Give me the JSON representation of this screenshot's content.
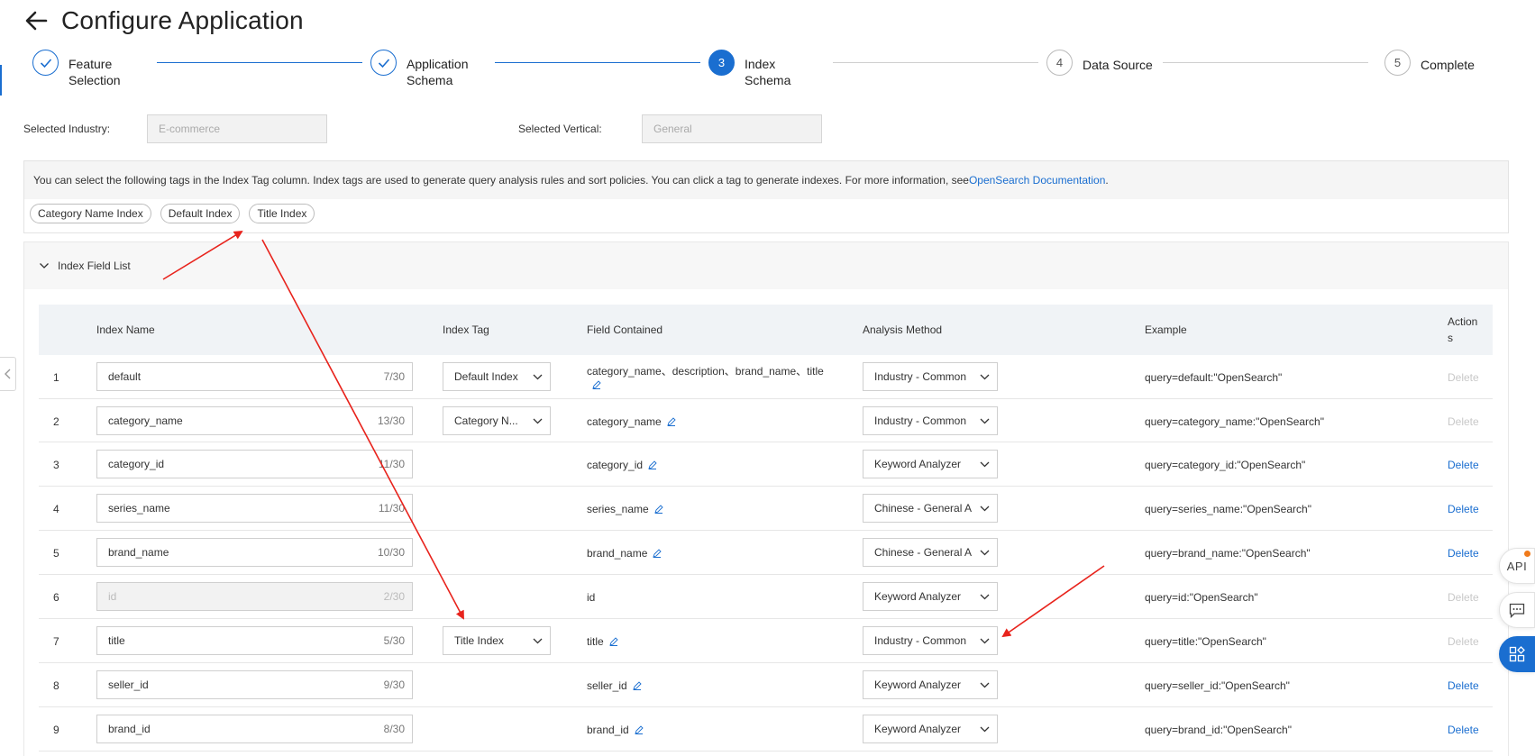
{
  "header": {
    "title": "Configure Application"
  },
  "steps": [
    {
      "number": "1",
      "label": "Feature\nSelection",
      "state": "done"
    },
    {
      "number": "2",
      "label": "Application\nSchema",
      "state": "done"
    },
    {
      "number": "3",
      "label": "Index\nSchema",
      "state": "active"
    },
    {
      "number": "4",
      "label": "Data Source",
      "state": "todo"
    },
    {
      "number": "5",
      "label": "Complete",
      "state": "todo"
    }
  ],
  "selection": {
    "industry_label": "Selected Industry:",
    "industry_value": "E-commerce",
    "vertical_label": "Selected Vertical:",
    "vertical_value": "General"
  },
  "info": {
    "text": "You can select the following tags in the Index Tag column. Index tags are used to generate query analysis rules and sort policies. You can click a tag to generate indexes. For more information, see",
    "link": "OpenSearch Documentation",
    "suffix": ".",
    "tags": [
      "Category Name Index",
      "Default Index",
      "Title Index"
    ]
  },
  "panel": {
    "title": "Index Field List"
  },
  "table": {
    "headers": {
      "index_name": "Index Name",
      "index_tag": "Index Tag",
      "field": "Field Contained",
      "method": "Analysis Method",
      "example": "Example",
      "actions": "Action\ns"
    },
    "rows": [
      {
        "n": "1",
        "name": "default",
        "count": "7/30",
        "tag": "Default Index",
        "field": "category_name、description、brand_name、title",
        "method": "Industry - Common",
        "example": "query=default:\"OpenSearch\"",
        "action": "Delete"
      },
      {
        "n": "2",
        "name": "category_name",
        "count": "13/30",
        "tag": "Category N...",
        "field": "category_name",
        "method": "Industry - Common",
        "example": "query=category_name:\"OpenSearch\"",
        "action": "Delete"
      },
      {
        "n": "3",
        "name": "category_id",
        "count": "11/30",
        "tag": "",
        "field": "category_id",
        "method": "Keyword Analyzer",
        "example": "query=category_id:\"OpenSearch\"",
        "action": "Delete"
      },
      {
        "n": "4",
        "name": "series_name",
        "count": "11/30",
        "tag": "",
        "field": "series_name",
        "method": "Chinese - General A",
        "example": "query=series_name:\"OpenSearch\"",
        "action": "Delete"
      },
      {
        "n": "5",
        "name": "brand_name",
        "count": "10/30",
        "tag": "",
        "field": "brand_name",
        "method": "Chinese - General A",
        "example": "query=brand_name:\"OpenSearch\"",
        "action": "Delete"
      },
      {
        "n": "6",
        "name": "id",
        "count": "2/30",
        "tag": "",
        "field": "id",
        "method": "Keyword Analyzer",
        "example": "query=id:\"OpenSearch\"",
        "action": "Delete"
      },
      {
        "n": "7",
        "name": "title",
        "count": "5/30",
        "tag": "Title Index",
        "field": "title",
        "method": "Industry - Common",
        "example": "query=title:\"OpenSearch\"",
        "action": "Delete"
      },
      {
        "n": "8",
        "name": "seller_id",
        "count": "9/30",
        "tag": "",
        "field": "seller_id",
        "method": "Keyword Analyzer",
        "example": "query=seller_id:\"OpenSearch\"",
        "action": "Delete"
      },
      {
        "n": "9",
        "name": "brand_id",
        "count": "8/30",
        "tag": "",
        "field": "brand_id",
        "method": "Keyword Analyzer",
        "example": "query=brand_id:\"OpenSearch\"",
        "action": "Delete"
      }
    ]
  },
  "floating": {
    "api_label": "API"
  },
  "colors": {
    "accent": "#1a6ed0",
    "annotation": "#e8231c",
    "disabled": "#c8c8c8"
  }
}
